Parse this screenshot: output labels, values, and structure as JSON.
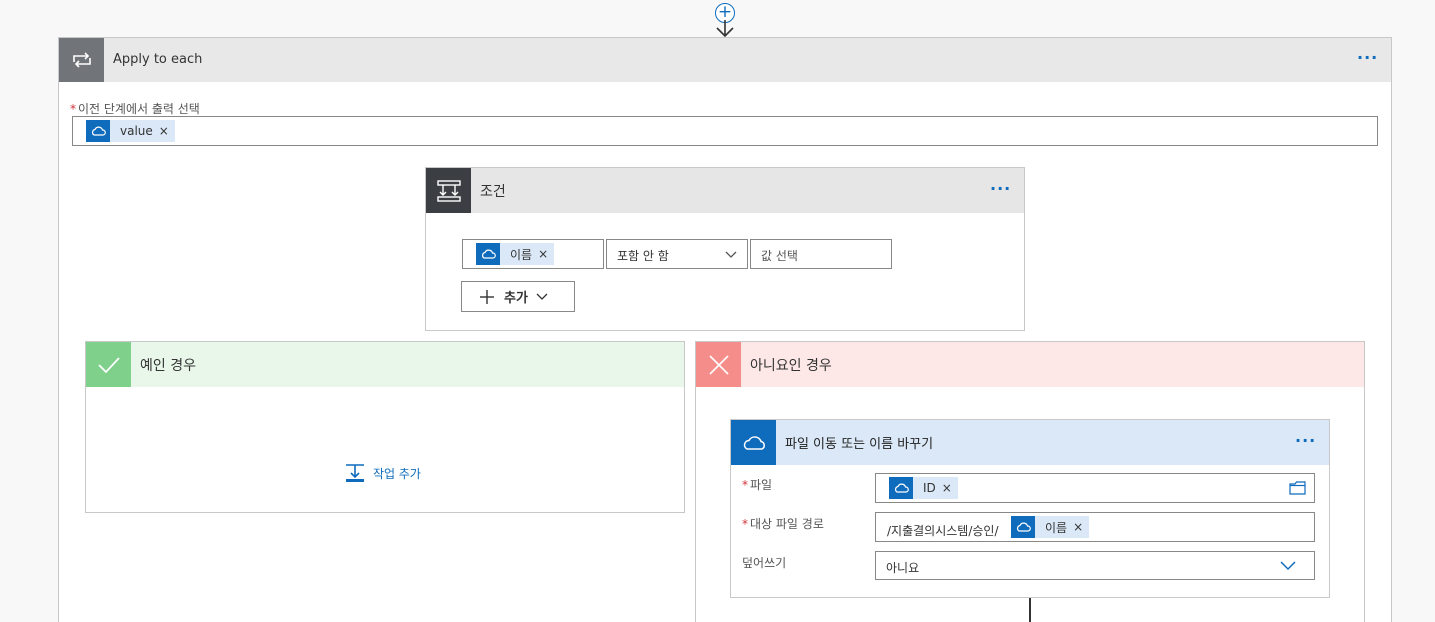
{
  "connector": {
    "plus_label": "+"
  },
  "apply_to_each": {
    "title": "Apply to each",
    "more_label": "···",
    "field_label": "이전 단계에서 출력 선택",
    "token": "value",
    "token_remove": "×"
  },
  "condition": {
    "title": "조건",
    "more_label": "···",
    "left_token": "이름",
    "token_remove": "×",
    "operator": "포함 안 함",
    "value_placeholder": "값 선택",
    "add_label": "추가"
  },
  "yes_branch": {
    "title": "예인 경우",
    "add_action_label": "작업 추가"
  },
  "no_branch": {
    "title": "아니요인 경우"
  },
  "move_action": {
    "title": "파일 이동 또는 이름 바꾸기",
    "more_label": "···",
    "file_label": "파일",
    "file_token": "ID",
    "dest_label": "대상 파일 경로",
    "dest_prefix": "/지출결의시스템/승인/",
    "dest_token": "이름",
    "overwrite_label": "덮어쓰기",
    "overwrite_value": "아니요",
    "token_remove": "×"
  },
  "colors": {
    "accent": "#0f6cbd",
    "yes": "#7fd08a",
    "no": "#f58e8a"
  }
}
